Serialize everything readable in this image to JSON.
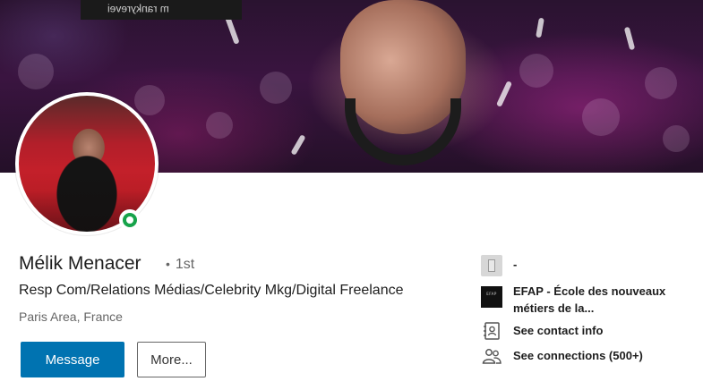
{
  "cover": {
    "banner_text": "ᴉǝʌǝɹʎʞuɐɹ ɯ"
  },
  "profile": {
    "name": "Mélik Menacer",
    "degree": "1st",
    "headline": "Resp Com/Relations Médias/Celebrity Mkg/Digital Freelance",
    "location": "Paris Area, France",
    "online_status_color": "#16a34a"
  },
  "actions": {
    "message_label": "Message",
    "more_label": "More..."
  },
  "sidebar": {
    "current_company": "-",
    "education_line1": "EFAP - École des nouveaux",
    "education_line2": "métiers de la...",
    "school_logo_text": "EFAP",
    "contact_label": "See contact info",
    "connections_label": "See connections (500+)"
  },
  "colors": {
    "primary_button": "#0073b1"
  }
}
